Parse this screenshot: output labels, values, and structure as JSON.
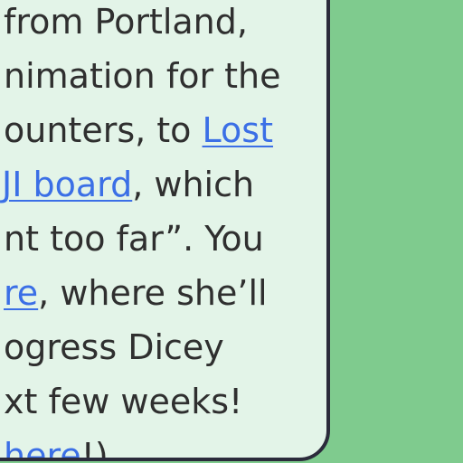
{
  "post": {
    "lines": [
      [
        {
          "t": "from Portland,"
        }
      ],
      [
        {
          "t": "nimation for the"
        }
      ],
      [
        {
          "t": "ounters, to "
        },
        {
          "t": "Lost ",
          "link": true
        }
      ],
      [
        {
          "t": "JI board",
          "link": true
        },
        {
          "t": ", which"
        }
      ],
      [
        {
          "t": "nt too far”. You"
        }
      ],
      [
        {
          "t": "re",
          "link": true
        },
        {
          "t": ", where she’ll"
        }
      ],
      [
        {
          "t": "ogress Dicey"
        }
      ],
      [
        {
          "t": "xt few weeks!"
        }
      ],
      [
        {
          "t": "here",
          "link": true
        },
        {
          "t": "!)"
        }
      ]
    ]
  },
  "colors": {
    "background": "#7fcb8e",
    "card": "#e3f4e8",
    "border": "#2b2b3b",
    "text": "#2f2f2f",
    "link": "#3b6fe6"
  }
}
